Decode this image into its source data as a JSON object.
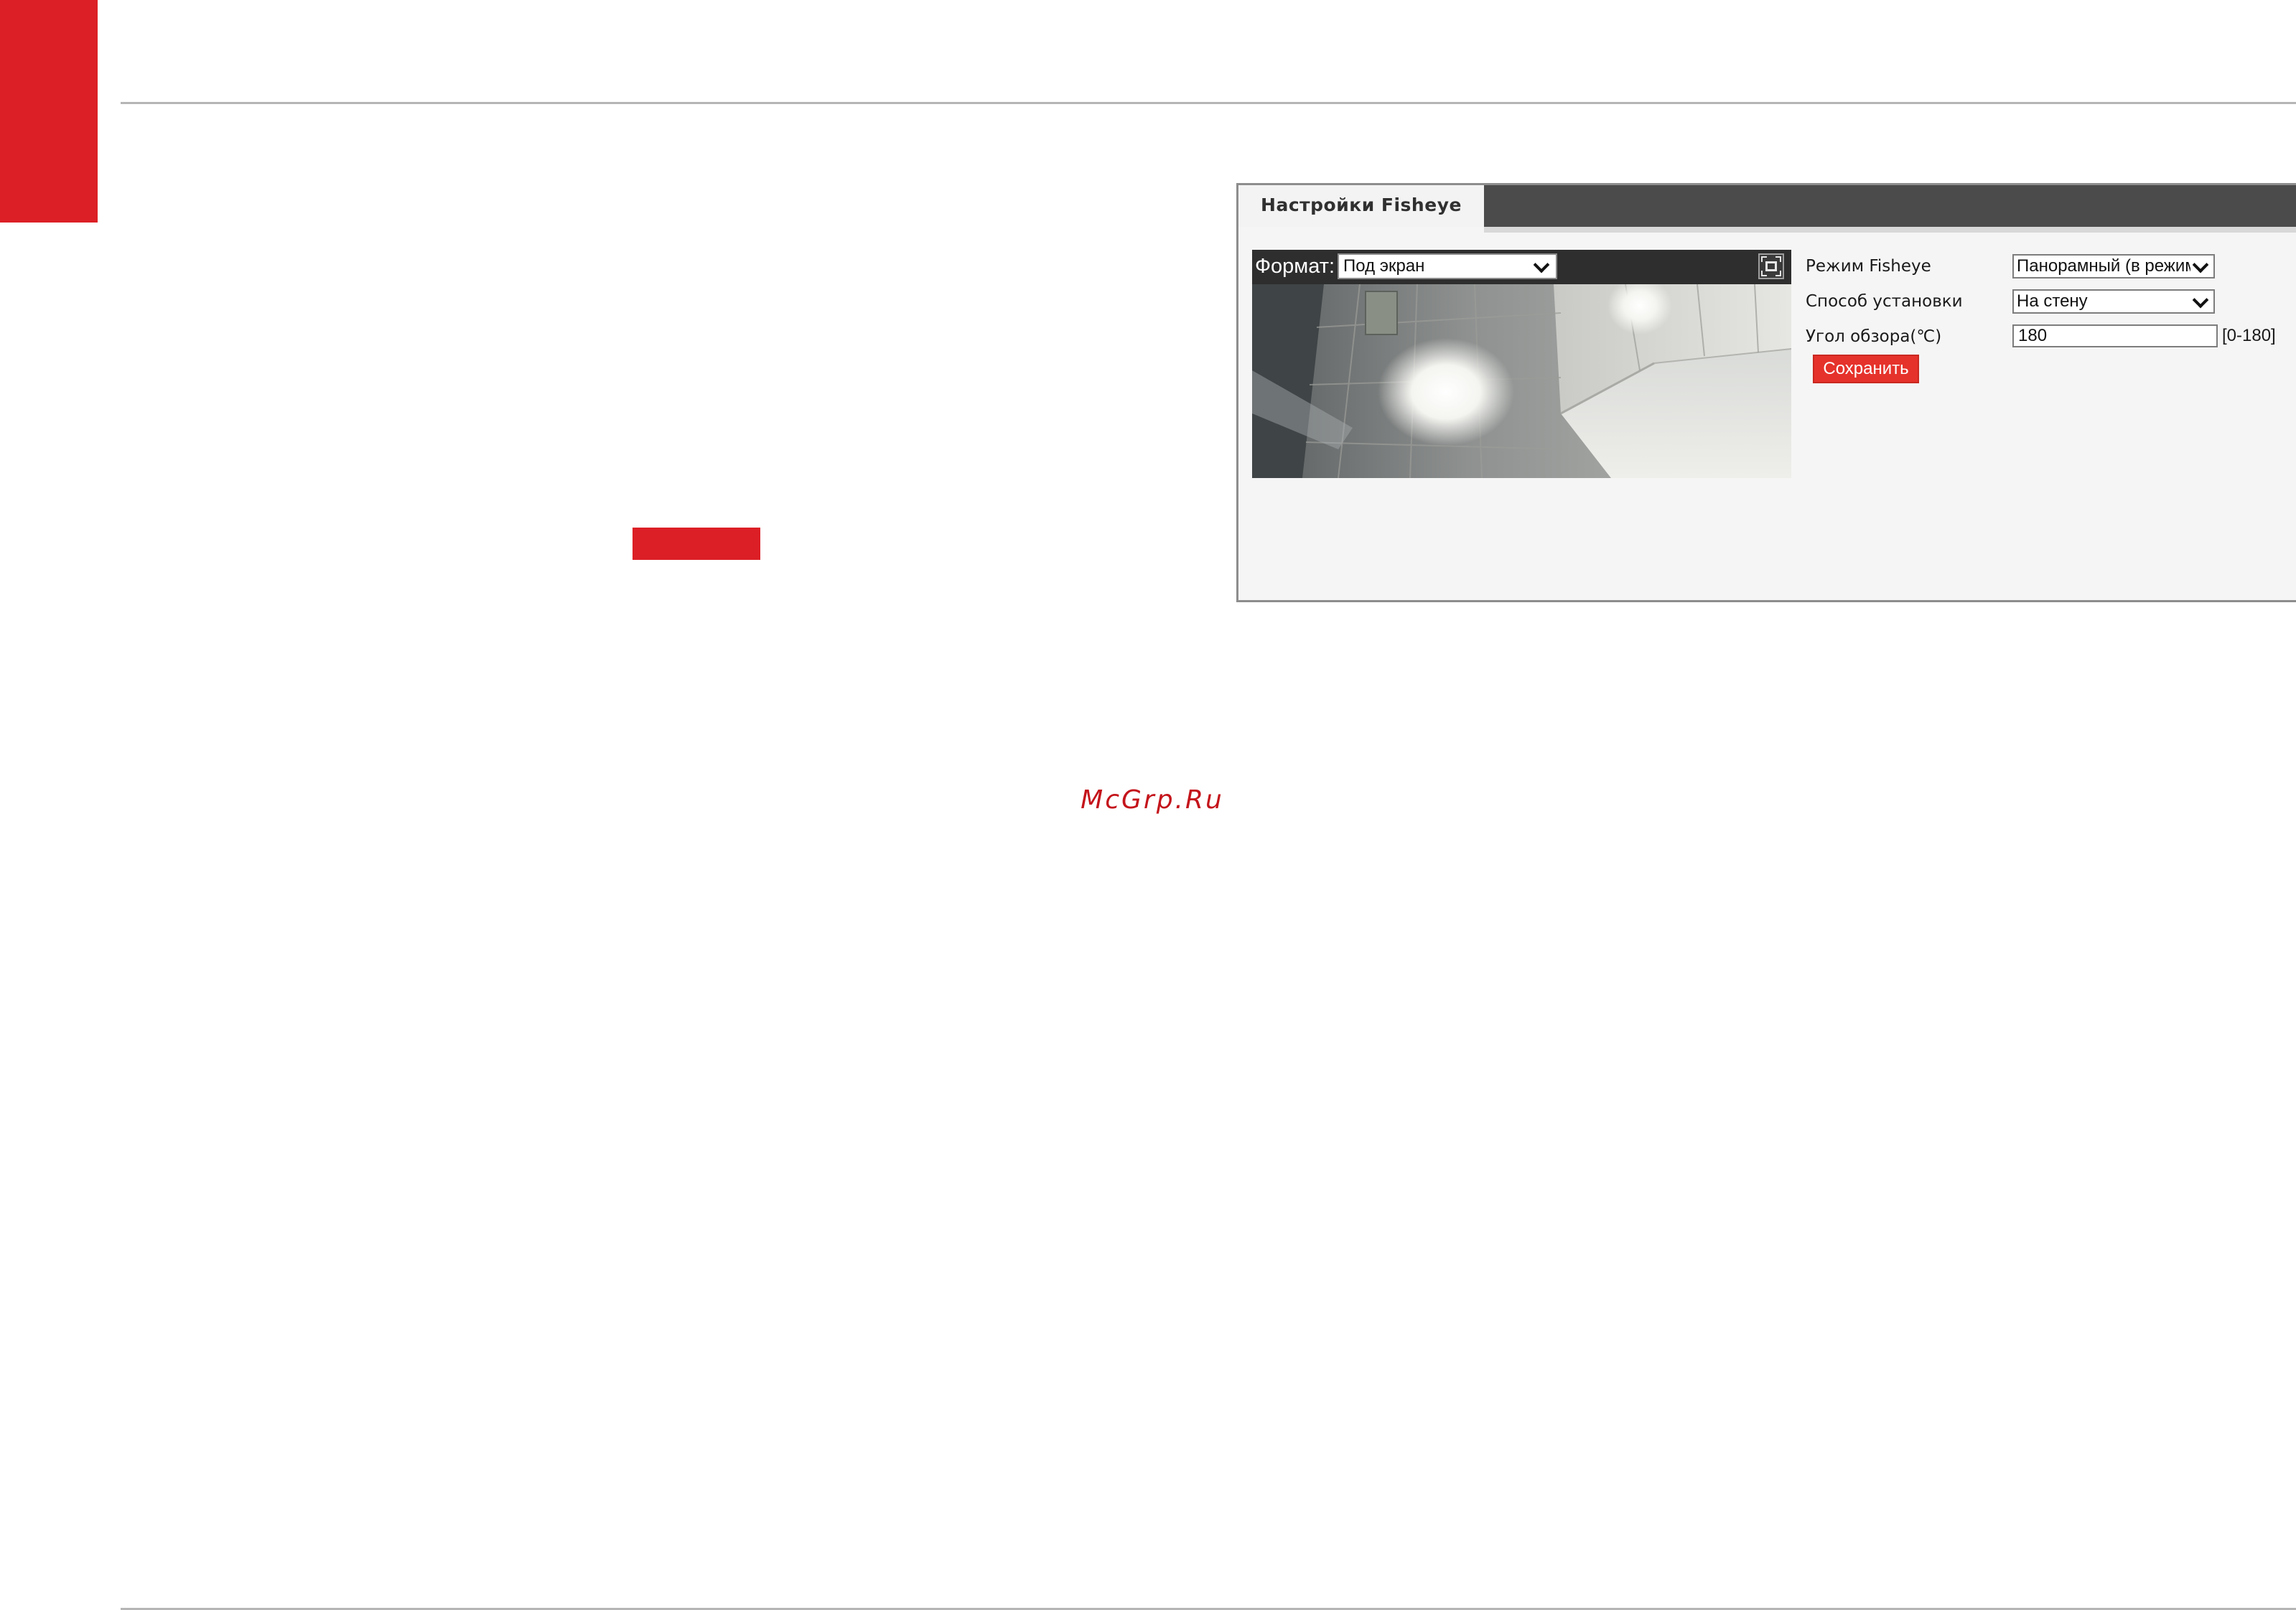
{
  "colors": {
    "brand_red": "#dc1f26",
    "save_button": "#e5322b",
    "tabbar": "#4b4b4b",
    "watermark": "#c4141b"
  },
  "panel": {
    "tab_label": "Настройки Fisheye",
    "video": {
      "format_label": "Формат:",
      "format_value": "Под экран",
      "fullscreen_icon": "fullscreen-icon"
    },
    "form": {
      "fisheye_mode": {
        "label": "Режим Fisheye",
        "value": "Панорамный (в режиме"
      },
      "mount_type": {
        "label": "Способ установки",
        "value": "На стену"
      },
      "view_angle": {
        "label": "Угол обзора(℃)",
        "value": "180",
        "range": "[0-180]"
      },
      "save_label": "Сохранить"
    }
  },
  "watermark": "McGrp.Ru"
}
